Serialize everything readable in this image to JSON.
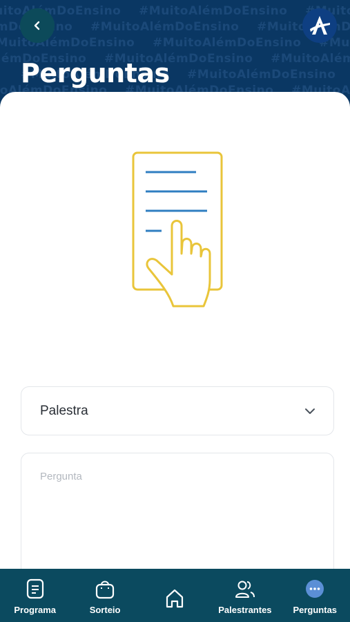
{
  "header": {
    "title": "Perguntas",
    "pattern_text": "#MuitoAlémDoEnsino",
    "back_icon": "chevron-left-icon",
    "logo_icon": "app-logo"
  },
  "form": {
    "select_value": "Palestra",
    "question_placeholder": "Pergunta"
  },
  "nav": {
    "items": [
      {
        "label": "Programa",
        "icon": "document-icon"
      },
      {
        "label": "Sorteio",
        "icon": "gift-icon"
      },
      {
        "label": "",
        "icon": "home-icon"
      },
      {
        "label": "Palestrantes",
        "icon": "people-icon"
      },
      {
        "label": "Perguntas",
        "icon": "chat-dots-icon"
      }
    ]
  },
  "colors": {
    "header_bg": "#0a3763",
    "nav_bg": "#0b4a5f",
    "illustration_yellow": "#e9c53a",
    "illustration_blue": "#2f7ec1"
  }
}
